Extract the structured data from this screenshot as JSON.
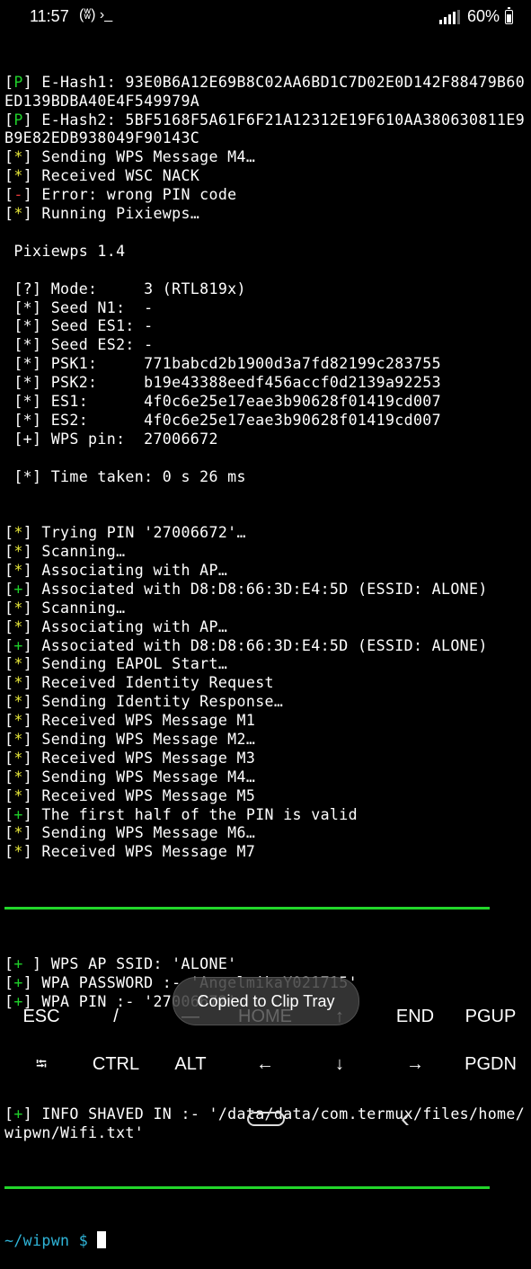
{
  "status_bar": {
    "time": "11:57",
    "left_icons": "(ʬ) ›_",
    "battery": "60%"
  },
  "terminal": {
    "lines": [
      {
        "tag": "P",
        "color": "g",
        "text": " E-Hash1: 93E0B6A12E69B8C02AA6BD1C7D02E0D142F88479B60"
      },
      {
        "tag": "",
        "color": "",
        "text": "ED139BDBA40E4F549979A"
      },
      {
        "tag": "P",
        "color": "g",
        "text": " E-Hash2: 5BF5168F5A61F6F21A12312E19F610AA380630811E9"
      },
      {
        "tag": "",
        "color": "",
        "text": "B9E82EDB938049F90143C"
      },
      {
        "tag": "*",
        "color": "y",
        "text": " Sending WPS Message M4…"
      },
      {
        "tag": "*",
        "color": "y",
        "text": " Received WSC NACK"
      },
      {
        "tag": "-",
        "color": "r",
        "text": " Error: wrong PIN code"
      },
      {
        "tag": "*",
        "color": "y",
        "text": " Running Pixiewps…"
      },
      {
        "tag": "",
        "color": "",
        "text": ""
      },
      {
        "tag": "",
        "color": "",
        "text": " Pixiewps 1.4"
      },
      {
        "tag": "",
        "color": "",
        "text": ""
      },
      {
        "tag": "",
        "color": "",
        "text": " [?] Mode:     3 (RTL819x)"
      },
      {
        "tag": "",
        "color": "",
        "text": " [*] Seed N1:  -"
      },
      {
        "tag": "",
        "color": "",
        "text": " [*] Seed ES1: -"
      },
      {
        "tag": "",
        "color": "",
        "text": " [*] Seed ES2: -"
      },
      {
        "tag": "",
        "color": "",
        "text": " [*] PSK1:     771babcd2b1900d3a7fd82199c283755"
      },
      {
        "tag": "",
        "color": "",
        "text": " [*] PSK2:     b19e43388eedf456accf0d2139a92253"
      },
      {
        "tag": "",
        "color": "",
        "text": " [*] ES1:      4f0c6e25e17eae3b90628f01419cd007"
      },
      {
        "tag": "",
        "color": "",
        "text": " [*] ES2:      4f0c6e25e17eae3b90628f01419cd007"
      },
      {
        "tag": "",
        "color": "",
        "text": " [+] WPS pin:  27006672"
      },
      {
        "tag": "",
        "color": "",
        "text": ""
      },
      {
        "tag": "",
        "color": "",
        "text": " [*] Time taken: 0 s 26 ms"
      },
      {
        "tag": "",
        "color": "",
        "text": ""
      },
      {
        "tag": "",
        "color": "",
        "text": ""
      },
      {
        "tag": "*",
        "color": "y",
        "text": " Trying PIN '27006672'…"
      },
      {
        "tag": "*",
        "color": "y",
        "text": " Scanning…"
      },
      {
        "tag": "*",
        "color": "y",
        "text": " Associating with AP…"
      },
      {
        "tag": "+",
        "color": "g",
        "text": " Associated with D8:D8:66:3D:E4:5D (ESSID: ALONE)"
      },
      {
        "tag": "*",
        "color": "y",
        "text": " Scanning…"
      },
      {
        "tag": "*",
        "color": "y",
        "text": " Associating with AP…"
      },
      {
        "tag": "+",
        "color": "g",
        "text": " Associated with D8:D8:66:3D:E4:5D (ESSID: ALONE)"
      },
      {
        "tag": "*",
        "color": "y",
        "text": " Sending EAPOL Start…"
      },
      {
        "tag": "*",
        "color": "y",
        "text": " Received Identity Request"
      },
      {
        "tag": "*",
        "color": "y",
        "text": " Sending Identity Response…"
      },
      {
        "tag": "*",
        "color": "y",
        "text": " Received WPS Message M1"
      },
      {
        "tag": "*",
        "color": "y",
        "text": " Sending WPS Message M2…"
      },
      {
        "tag": "*",
        "color": "y",
        "text": " Received WPS Message M3"
      },
      {
        "tag": "*",
        "color": "y",
        "text": " Sending WPS Message M4…"
      },
      {
        "tag": "*",
        "color": "y",
        "text": " Received WPS Message M5"
      },
      {
        "tag": "+",
        "color": "g",
        "text": " The first half of the PIN is valid"
      },
      {
        "tag": "*",
        "color": "y",
        "text": " Sending WPS Message M6…"
      },
      {
        "tag": "*",
        "color": "y",
        "text": " Received WPS Message M7"
      }
    ],
    "result_lines": [
      {
        "tag": "+ ",
        "color": "g",
        "text": " WPS AP SSID: 'ALONE'"
      },
      {
        "tag": "+",
        "color": "g",
        "text": " WPA PASSWORD :- 'AngelmikaY021715'"
      },
      {
        "tag": "+",
        "color": "g",
        "text": " WPA PIN :- '27006672'"
      }
    ],
    "info_lines": [
      {
        "tag": "+",
        "color": "g",
        "text": " INFO SHAVED IN :- '/data/data/com.termux/files/home/"
      },
      {
        "tag": "",
        "color": "",
        "text": "wipwn/Wifi.txt'"
      }
    ],
    "prompt": "~/wipwn $ "
  },
  "toast": "Copied to Clip Tray",
  "extra_keys": {
    "row1": [
      "ESC",
      "/",
      "—",
      "HOME",
      "↑",
      "END",
      "PGUP"
    ],
    "row2": [
      "⭾",
      "CTRL",
      "ALT",
      "←",
      "↓",
      "→",
      "PGDN"
    ]
  },
  "colors": {
    "green": "#1fd12a",
    "yellow": "#e9e93a",
    "red": "#e33b3b",
    "prompt": "#2fb4d8"
  }
}
